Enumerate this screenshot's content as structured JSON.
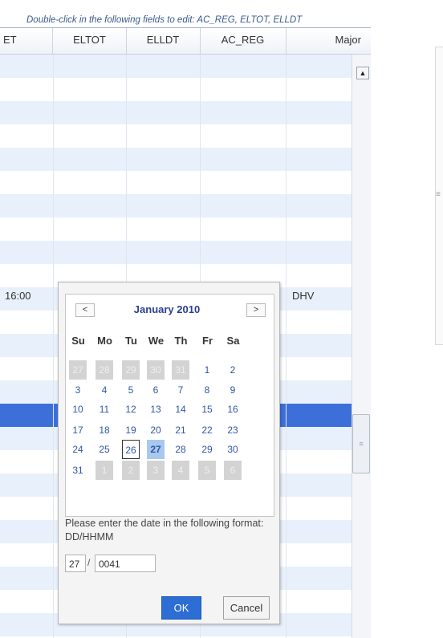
{
  "hint": "Double-click in the following fields to edit: AC_REG, ELTOT, ELLDT",
  "columns": [
    "ET",
    "ELTOT",
    "ELLDT",
    "AC_REG",
    "Major"
  ],
  "row_values": {
    "et_time": "16:00",
    "major": "DHV"
  },
  "scroll_up_glyph": "▲",
  "scroll_grip_glyph": "≡",
  "calendar": {
    "prev_label": "<",
    "next_label": ">",
    "month_year": "January 2010",
    "weekdays": [
      "Su",
      "Mo",
      "Tu",
      "We",
      "Th",
      "Fr",
      "Sa"
    ],
    "weeks": [
      [
        "27",
        "28",
        "29",
        "30",
        "31",
        "1",
        "2"
      ],
      [
        "3",
        "4",
        "5",
        "6",
        "7",
        "8",
        "9"
      ],
      [
        "10",
        "11",
        "12",
        "13",
        "14",
        "15",
        "16"
      ],
      [
        "17",
        "18",
        "19",
        "20",
        "21",
        "22",
        "23"
      ],
      [
        "24",
        "25",
        "26",
        "27",
        "28",
        "29",
        "30"
      ],
      [
        "31",
        "1",
        "2",
        "3",
        "4",
        "5",
        "6"
      ]
    ],
    "today": "26",
    "selected": "27"
  },
  "format_note": "Please enter the date in the following format: DD/HHMM",
  "inputs": {
    "day": "27",
    "separator": "/",
    "time": "0041"
  },
  "buttons": {
    "ok": "OK",
    "cancel": "Cancel"
  }
}
